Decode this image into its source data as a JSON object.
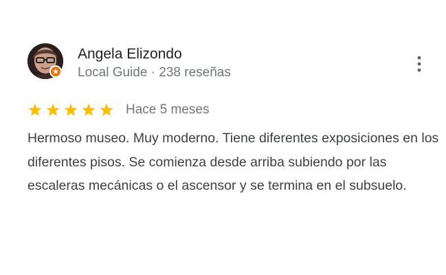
{
  "reviewer": {
    "name": "Angela Elizondo",
    "meta": "Local Guide · 238 reseñas",
    "avatar_icon": "user-photo",
    "badge_icon": "local-guide-star-icon",
    "badge_color": "#e8710a"
  },
  "rating": {
    "stars": 5,
    "max_stars": 5,
    "star_color": "#fbbc04"
  },
  "date": "Hace 5 meses",
  "review_text": "Hermoso museo. Muy moderno. Tiene diferentes exposiciones en los diferentes pisos. Se comienza desde arriba subiendo por las escaleras mecánicas o el ascensor y se termina en el subsuelo.",
  "menu_icon": "more-vert-icon"
}
